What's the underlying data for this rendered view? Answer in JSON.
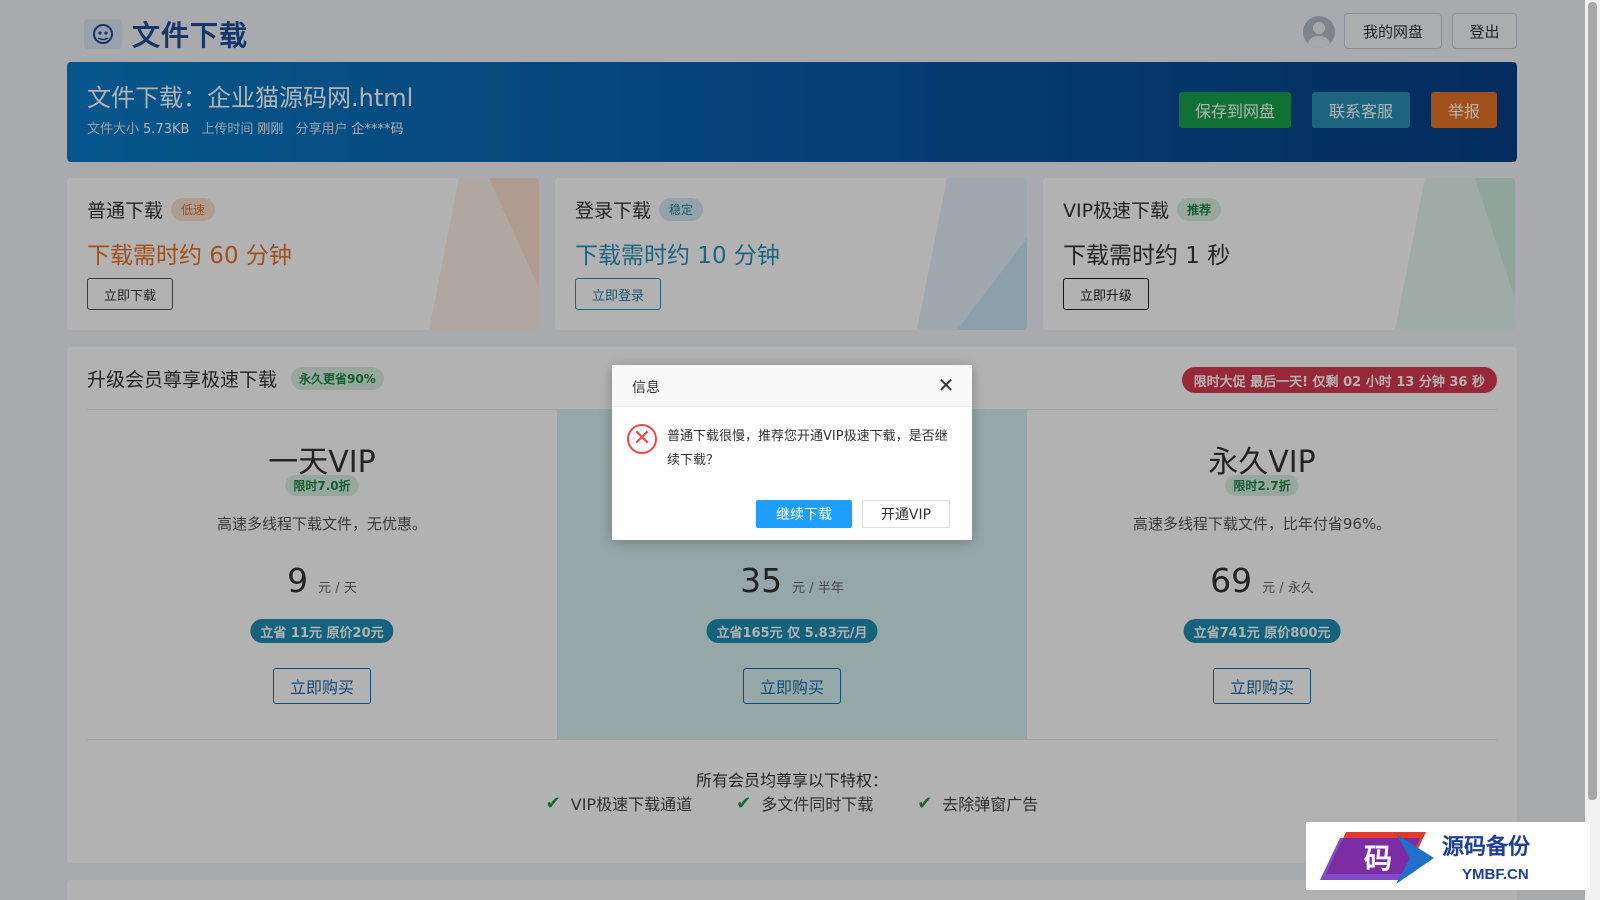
{
  "header": {
    "title": "文件下载",
    "my_drive": "我的网盘",
    "logout": "登出"
  },
  "hero": {
    "title": "文件下载：企业猫源码网.html",
    "size_label": "文件大小",
    "size_value": "5.73KB",
    "upload_label": "上传时间",
    "upload_value": "刚刚",
    "sharer_label": "分享用户",
    "sharer_value": "企****码",
    "save_button": "保存到网盘",
    "contact_button": "联系客服",
    "report_button": "举报"
  },
  "cards": [
    {
      "title": "普通下载",
      "badge": "低速",
      "time": "下载需时约 60 分钟",
      "button": "立即下载"
    },
    {
      "title": "登录下载",
      "badge": "稳定",
      "time": "下载需时约 10 分钟",
      "button": "立即登录"
    },
    {
      "title": "VIP极速下载",
      "badge": "推荐",
      "time": "下载需时约 1 秒",
      "button": "立即升级"
    }
  ],
  "vip": {
    "title": "升级会员尊享极速下载",
    "badge": "永久更省90%",
    "promo": "限时大促 最后一天! 仅剩 02 小时 13 分钟 36 秒",
    "plans": [
      {
        "name": "一天VIP",
        "discount": "限时7.0折",
        "desc": "高速多线程下载文件，无优惠。",
        "price": "9",
        "unit": "元 / 天",
        "save": "立省 11元 原价20元",
        "buy": "立即购买"
      },
      {
        "name": "",
        "discount": "",
        "desc": "",
        "price": "35",
        "unit": "元 / 半年",
        "save": "立省165元 仅 5.83元/月",
        "buy": "立即购买"
      },
      {
        "name": "永久VIP",
        "discount": "限时2.7折",
        "desc": "高速多线程下载文件，比年付省96%。",
        "price": "69",
        "unit": "元 / 永久",
        "save": "立省741元 原价800元",
        "buy": "立即购买"
      }
    ],
    "privileges_title": "所有会员均尊享以下特权：",
    "privileges": [
      "VIP极速下载通道",
      "多文件同时下载",
      "去除弹窗广告"
    ]
  },
  "dialog": {
    "title": "信息",
    "message": "普通下载很慢，推荐您开通VIP极速下载，是否继续下载？",
    "continue_button": "继续下载",
    "vip_button": "开通VIP"
  },
  "watermark": {
    "main": "源码备份",
    "sub": "YMBF.CN",
    "logo_char": "码"
  },
  "colors": {
    "brand": "#1e4e95",
    "hero_start": "#0b7cc8",
    "hero_end": "#063f86",
    "save_green": "#16a34a",
    "contact_teal": "#2a91b5",
    "report_orange": "#e67328",
    "slow_orange": "#e67328",
    "stable_teal": "#2a91b5",
    "promo_red": "#d93a4f",
    "dialog_blue": "#1e9fff"
  }
}
